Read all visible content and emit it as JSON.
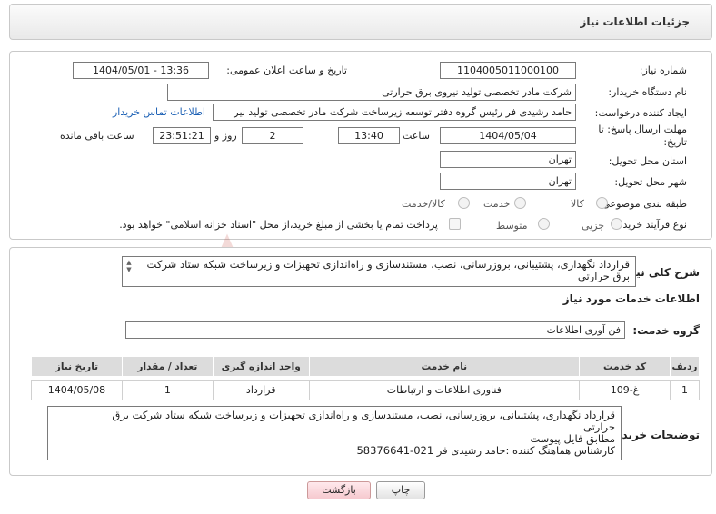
{
  "header": {
    "title": "جزئیات اطلاعات نیاز"
  },
  "form": {
    "need_number": {
      "label": "شماره نیاز:",
      "value": "1104005011000100"
    },
    "announce_datetime": {
      "label": "تاریخ و ساعت اعلان عمومی:",
      "value": "1404/05/01 - 13:36"
    },
    "buyer_org": {
      "label": "نام دستگاه خریدار:",
      "value": "شرکت مادر تخصصی تولید نیروی برق حرارتی"
    },
    "requester": {
      "label": "ایجاد کننده درخواست:",
      "value": "حامد رشیدی فر رئیس گروه دفتر توسعه زیرساخت شرکت مادر تخصصی تولید نیر",
      "contact_link": "اطلاعات تماس خریدار"
    },
    "deadline": {
      "label": "مهلت ارسال پاسخ: تا تاریخ:",
      "date": "1404/05/04",
      "time_label": "ساعت",
      "time": "13:40",
      "days": "2",
      "days_label": "روز و",
      "remaining": "23:51:21",
      "remaining_label": "ساعت باقی مانده"
    },
    "province": {
      "label": "استان محل تحویل:",
      "value": "تهران"
    },
    "city": {
      "label": "شهر محل تحویل:",
      "value": "تهران"
    },
    "category": {
      "label": "طبقه بندی موضوعی:",
      "options": [
        "کالا",
        "خدمت",
        "کالا/خدمت"
      ]
    },
    "purchase_type": {
      "label": "نوع فرآیند خرید :",
      "options": [
        "جزیی",
        "متوسط"
      ],
      "treasury_note": "پرداخت تمام یا بخشی از مبلغ خرید،از محل \"اسناد خزانه اسلامی\" خواهد بود."
    }
  },
  "summary": {
    "label": "شرح کلی نیاز:",
    "text": "قرارداد نگهداری، پشتیبانی، بروزرسانی، نصب، مستندسازی و راه‌اندازی تجهیزات و زیرساخت شبکه ستاد شرکت برق حرارتی"
  },
  "services": {
    "section_title": "اطلاعات خدمات مورد نیاز",
    "group_label": "گروه خدمت:",
    "group_value": "فن آوری اطلاعات",
    "columns": [
      "ردیف",
      "کد خدمت",
      "نام خدمت",
      "واحد اندازه گیری",
      "تعداد / مقدار",
      "تاریخ نیاز"
    ],
    "rows": [
      [
        "1",
        "غ-109",
        "فناوری اطلاعات و ارتباطات",
        "قرارداد",
        "1",
        "1404/05/08"
      ]
    ]
  },
  "buyer_notes": {
    "label": "توضیحات خریدار:",
    "lines": [
      "قرارداد نگهداری، پشتیبانی، بروزرسانی، نصب، مستندسازی و راه‌اندازی تجهیزات و زیرساخت شبکه ستاد شرکت برق",
      "حرارتی",
      "مطابق فایل پیوست",
      "کارشناس هماهنگ کننده :حامد رشیدی فر 021-58376641"
    ]
  },
  "buttons": {
    "print": "چاپ",
    "back": "بازگشت"
  },
  "colors": {
    "link": "#1a5fb4",
    "back_button": "#f6c9cf",
    "table_header": "#dcdcdc"
  }
}
